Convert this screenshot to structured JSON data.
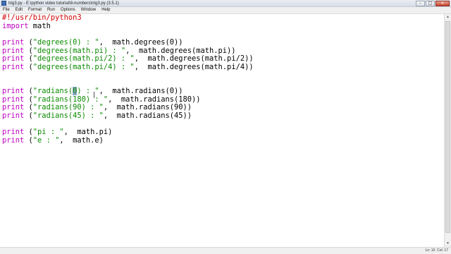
{
  "window": {
    "title": "trig3.py - E:\\python video tutorial\\8-numbers\\trig3.py (3.5.1)",
    "minimize_glyph": "–",
    "maximize_glyph": "□",
    "close_glyph": "✕"
  },
  "menu": [
    "File",
    "Edit",
    "Format",
    "Run",
    "Options",
    "Window",
    "Help"
  ],
  "code": {
    "shebang": "#!/usr/bin/python3",
    "import_kw": "import",
    "import_mod": " math",
    "print_kw": "print",
    "lines": [
      {
        "str": "\"degrees(0) : \"",
        "rest": ",  math.degrees(0))"
      },
      {
        "str": "\"degrees(math.pi) : \"",
        "rest": ",  math.degrees(math.pi))"
      },
      {
        "str": "\"degrees(math.pi/2) : \"",
        "rest": ",  math.degrees(math.pi/2))"
      },
      {
        "str": "\"degrees(math.pi/4) : \"",
        "rest": ",  math.degrees(math.pi/4))"
      },
      {
        "str_a": "\"radians(",
        "str_sel": "0",
        "str_b": ") : \"",
        "rest": ",  math.radians(0))"
      },
      {
        "str": "\"radians(180) : \"",
        "rest": ",  math.radians(180))"
      },
      {
        "str": "\"radians(90) : \"",
        "rest": ",  math.radians(90))"
      },
      {
        "str": "\"radians(45) : \"",
        "rest": ",  math.radians(45))"
      },
      {
        "str": "\"pi : \"",
        "rest": ",  math.pi)"
      },
      {
        "str": "\"e : \"",
        "rest": ",  math.e)"
      }
    ],
    "open_paren": " ("
  },
  "status": {
    "line": "Ln: 10",
    "col": "Col: 17"
  },
  "colors": {
    "keyword": "#c000c0",
    "string": "#0a8a00",
    "comment": "#d20000",
    "selection": "#8fa8c8"
  }
}
